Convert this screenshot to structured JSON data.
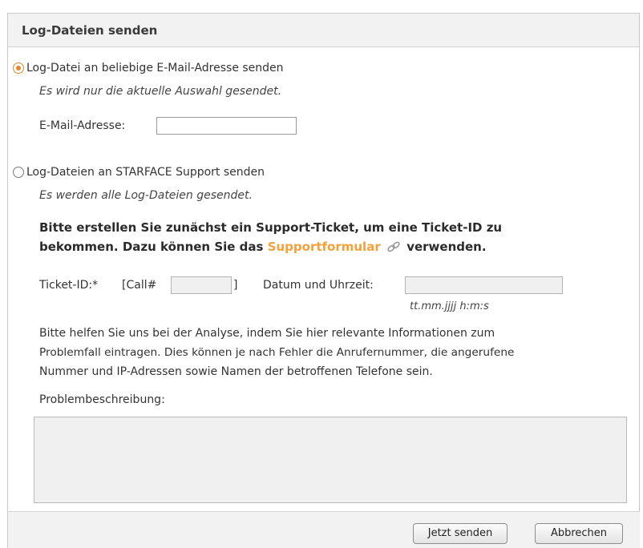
{
  "dialog": {
    "title": "Log-Dateien senden"
  },
  "option_email": {
    "label": "Log-Datei an beliebige E-Mail-Adresse senden",
    "note": "Es wird nur die aktuelle Auswahl gesendet.",
    "email_label": "E-Mail-Adresse:",
    "email_value": "",
    "selected": true
  },
  "option_support": {
    "label": "Log-Dateien an STARFACE Support senden",
    "note": "Es werden alle Log-Dateien gesendet.",
    "instruction_part1": "Bitte erstellen Sie zunächst ein Support-Ticket, um eine Ticket-ID zu",
    "instruction_part2": "bekommen. Dazu können Sie das ",
    "instruction_link": "Supportformular",
    "instruction_part3": "verwenden.",
    "ticket_label": "Ticket-ID:*",
    "call_prefix": "[Call#",
    "call_suffix": "]",
    "ticket_value": "",
    "datetime_label": "Datum und Uhrzeit:",
    "datetime_value": "",
    "datetime_hint": "tt.mm.jjjj h:m:s",
    "help_line1": "Bitte helfen Sie uns bei der Analyse, indem Sie hier relevante Informationen zum",
    "help_line2": "Problemfall eintragen. Dies können je nach Fehler die Anrufernummer, die angerufene",
    "help_line3": "Nummer und IP-Adressen sowie Namen der betroffenen Telefone sein.",
    "problem_label": "Problembeschreibung:",
    "problem_value": "",
    "selected": false
  },
  "footer": {
    "send_label": "Jetzt senden",
    "cancel_label": "Abbrechen"
  },
  "colors": {
    "link": "#f5a13a",
    "radio_selected": "#e8872a",
    "header_bg": "#f2f2f2"
  },
  "icons": {
    "external_link": "external-link-icon"
  }
}
